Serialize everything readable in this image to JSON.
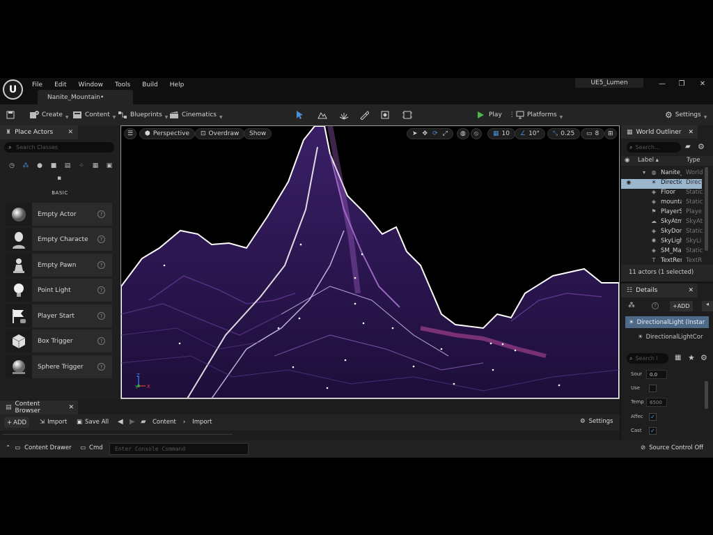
{
  "menu": [
    "File",
    "Edit",
    "Window",
    "Tools",
    "Build",
    "Help"
  ],
  "document_tab": "Nanite_Mountain•",
  "project_name": "UE5_Lumen",
  "toolbar": {
    "create": "Create",
    "content": "Content",
    "blueprints": "Blueprints",
    "cinematics": "Cinematics",
    "play": "Play",
    "platforms": "Platforms",
    "settings": "Settings"
  },
  "place_actors": {
    "tab": "Place Actors",
    "search_placeholder": "Search Classes",
    "section": "BASIC",
    "items": [
      "Empty Actor",
      "Empty Characte",
      "Empty Pawn",
      "Point Light",
      "Player Start",
      "Box Trigger",
      "Sphere Trigger"
    ]
  },
  "viewport": {
    "perspective": "Perspective",
    "overdraw": "Overdraw",
    "show": "Show",
    "grid_snap": "10",
    "rotation_snap": "10°",
    "scale_snap": "0.25",
    "camera_speed": "8"
  },
  "outliner": {
    "tab": "World Outliner",
    "search_placeholder": "Search...",
    "col_label": "Label",
    "col_type": "Type",
    "rows": [
      {
        "label": "Nanite_M",
        "type": "World"
      },
      {
        "label": "Directic",
        "type": "Direct"
      },
      {
        "label": "Floor",
        "type": "Static"
      },
      {
        "label": "mounta",
        "type": "Static"
      },
      {
        "label": "PlayerS",
        "type": "Playe"
      },
      {
        "label": "SkyAtm",
        "type": "SkyAt"
      },
      {
        "label": "SkyDon",
        "type": "Static"
      },
      {
        "label": "SkyLigh",
        "type": "SkyLi"
      },
      {
        "label": "SM_Ma",
        "type": "Static"
      },
      {
        "label": "TextRer",
        "type": "TextR"
      }
    ],
    "footer": "11 actors (1 selected)"
  },
  "details": {
    "tab": "Details",
    "add": "ADD",
    "component_selected": "DirectionalLight (Instar",
    "component_child": "DirectionalLightCor",
    "search_placeholder": "Search I",
    "props": [
      {
        "label": "Sour",
        "value": "0.0"
      },
      {
        "label": "Use ",
        "value": ""
      },
      {
        "label": "Temp",
        "value": "6500"
      },
      {
        "label": "Affec",
        "value": "✓"
      },
      {
        "label": "Cast",
        "value": "✓"
      }
    ]
  },
  "content_browser": {
    "tab": "Content Browser",
    "add": "ADD",
    "import": "Import",
    "save_all": "Save All",
    "path": [
      "Content",
      "Import"
    ],
    "settings": "Settings"
  },
  "status": {
    "drawer": "Content Drawer",
    "cmd": "Cmd",
    "console_placeholder": "Enter Console Command",
    "source_control": "Source Control Off"
  },
  "colors": {
    "accent": "#4a8fd8",
    "play": "#4cb84c",
    "mesh_dark": "#2a1548",
    "mesh_bright": "#8a3cb0"
  }
}
